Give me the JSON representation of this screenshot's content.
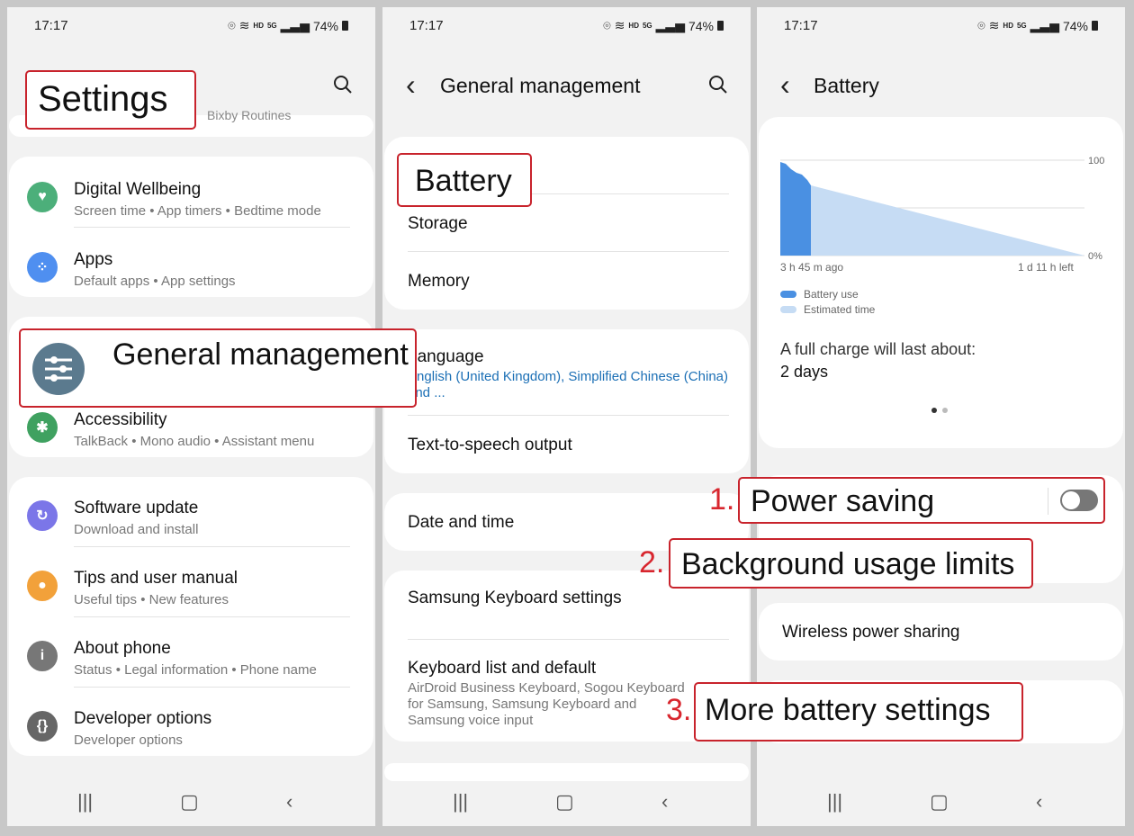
{
  "status": {
    "time": "17:17",
    "battery_pct": "74%",
    "hd": "HD",
    "net": "5G"
  },
  "panel1": {
    "title": "Settings",
    "hidden_item": "Bixby Routines",
    "items": [
      {
        "title": "Digital Wellbeing",
        "sub": "Screen time  •  App timers  •  Bedtime mode",
        "color": "#4caf7a"
      },
      {
        "title": "Apps",
        "sub": "Default apps  •  App settings",
        "color": "#4f8ff0"
      },
      {
        "title": "Accessibility",
        "sub": "TalkBack  •  Mono audio  •  Assistant menu",
        "color": "#3fa160"
      },
      {
        "title": "Software update",
        "sub": "Download and install",
        "color": "#7b76e8"
      },
      {
        "title": "Tips and user manual",
        "sub": "Useful tips  •  New features",
        "color": "#f2a13a"
      },
      {
        "title": "About phone",
        "sub": "Status  •  Legal information  •  Phone name",
        "color": "#777777"
      },
      {
        "title": "Developer options",
        "sub": "Developer options",
        "color": "#666666"
      }
    ],
    "highlight": "General management"
  },
  "panel2": {
    "title": "General management",
    "highlight": "Battery",
    "items": [
      "Storage",
      "Memory"
    ],
    "language_title": "Language",
    "language_sub": "English (United Kingdom), Simplified Chinese (China) and ...",
    "tts": "Text-to-speech output",
    "date": "Date and time",
    "keyboard": "Samsung Keyboard settings",
    "keyboard_list": "Keyboard list and default",
    "keyboard_list_sub": "AirDroid Business Keyboard, Sogou Keyboard for Samsung, Samsung Keyboard and Samsung voice input"
  },
  "panel3": {
    "title": "Battery",
    "chart_data": {
      "type": "area",
      "y_ticks": [
        "100",
        "0%"
      ],
      "x_labels": [
        "3 h 45 m ago",
        "1 d 11 h left"
      ],
      "legend": [
        "Battery use",
        "Estimated time"
      ],
      "series": [
        {
          "name": "Battery use",
          "color": "#4a90e2"
        },
        {
          "name": "Estimated time",
          "color": "#c6dcf4"
        }
      ]
    },
    "full_charge_label": "A full charge will last about:",
    "full_charge_value": "2 days",
    "power_saving": "Power saving",
    "background": "Background usage limits",
    "wireless": "Wireless power sharing",
    "more": "More battery settings",
    "num1": "1.",
    "num2": "2.",
    "num3": "3."
  }
}
